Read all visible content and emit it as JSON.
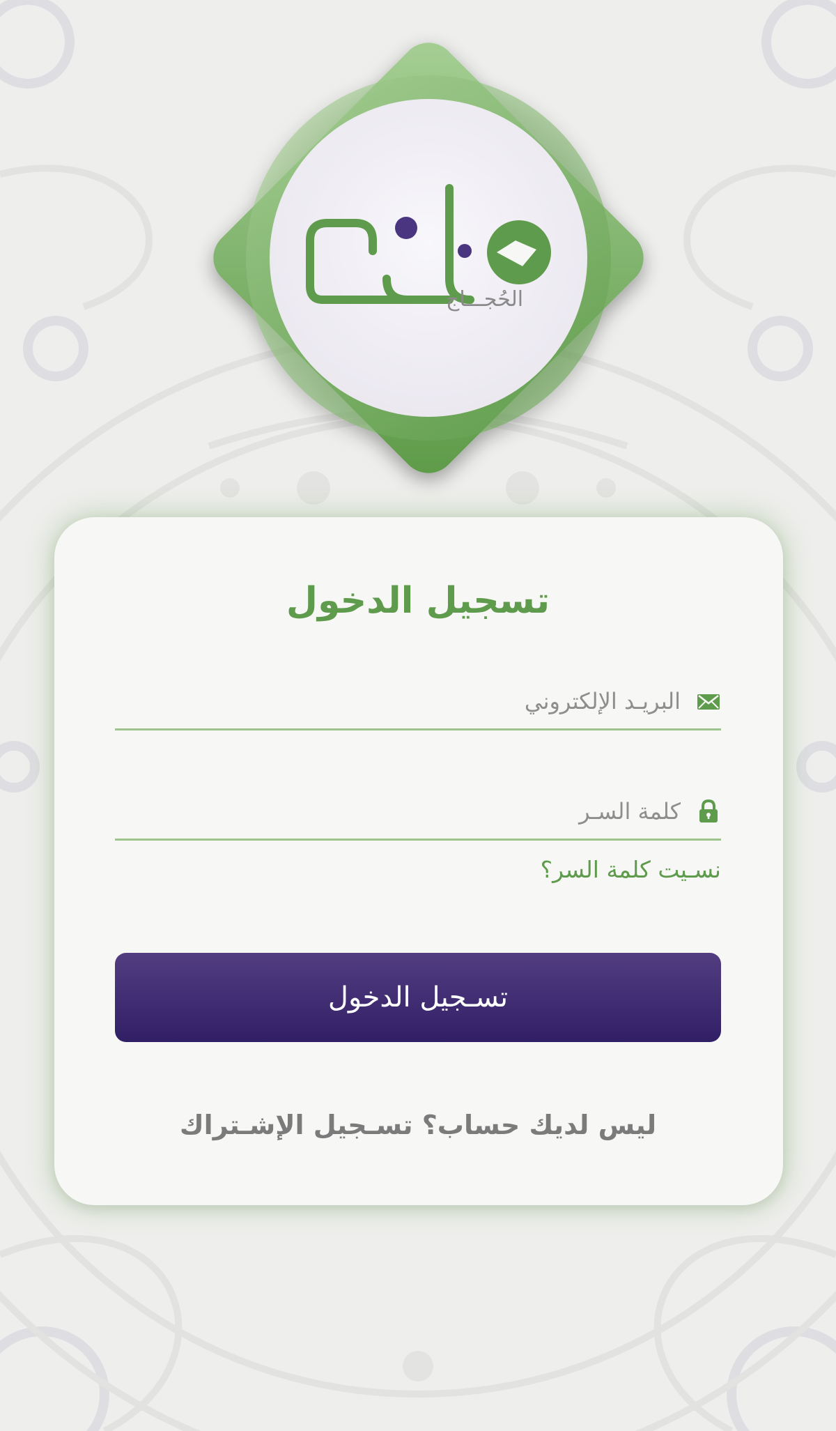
{
  "logo": {
    "subtitle": "الحُجـــاج",
    "colors": {
      "green": "#5f9b4c",
      "purple": "#4a3580",
      "disc": "#f1eff5"
    }
  },
  "login": {
    "title": "تسجيل الدخول",
    "email_placeholder": "البريـد الإلكتروني",
    "email_icon": "envelope-icon",
    "password_placeholder": "كلمة السـر",
    "password_icon": "lock-icon",
    "forgot_password": "نسـيت كلمة السر؟",
    "submit_label": "تسـجيل الدخول",
    "signup_prompt": "ليس لديك حساب؟",
    "signup_link": "تسـجيل الإشـتراك"
  },
  "theme": {
    "accent_green": "#5f9b4c",
    "button_purple_top": "#523d80",
    "button_purple_bottom": "#311f66",
    "card_bg": "#f7f7f5",
    "page_bg": "#eeeeec"
  }
}
